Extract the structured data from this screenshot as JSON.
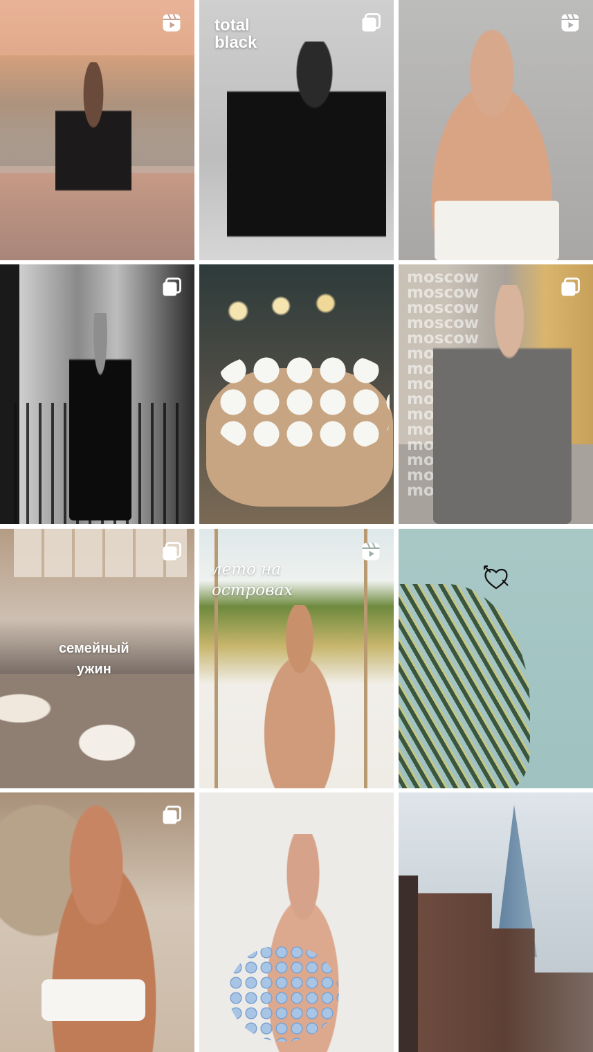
{
  "grid": {
    "tiles": [
      {
        "id": "rooftop-black-dress",
        "type": "reel",
        "caption": ""
      },
      {
        "id": "total-black-studio",
        "type": "carousel",
        "caption_line1": "total",
        "caption_line2": "black"
      },
      {
        "id": "pearl-necklace-portrait",
        "type": "reel",
        "caption": ""
      },
      {
        "id": "balcony-bw",
        "type": "carousel",
        "caption": ""
      },
      {
        "id": "white-roses-bouquet",
        "type": "none",
        "caption": ""
      },
      {
        "id": "moscow-coat",
        "type": "carousel",
        "caption": "moscow",
        "repeat_lines": [
          "moscow",
          "moscow",
          "moscow",
          "moscow",
          "moscow",
          "moscow",
          "moscow",
          "moscow",
          "mosco",
          "mosc",
          "mos",
          "mo",
          "mo",
          "mo",
          "mo"
        ]
      },
      {
        "id": "family-dinner",
        "type": "carousel",
        "caption_line1": "семейный",
        "caption_line2": "ужин"
      },
      {
        "id": "island-swing",
        "type": "reel",
        "caption_line1": "лето на",
        "caption_line2": "островах"
      },
      {
        "id": "palm-sky",
        "type": "none",
        "icon": "heart-arrow-icon"
      },
      {
        "id": "beach-smile",
        "type": "carousel",
        "caption": ""
      },
      {
        "id": "hydrangea-bouquet",
        "type": "none",
        "caption": ""
      },
      {
        "id": "shard-london",
        "type": "none",
        "caption": ""
      }
    ]
  },
  "colors": {
    "background": "#ffffff",
    "badge": "#ffffff"
  }
}
